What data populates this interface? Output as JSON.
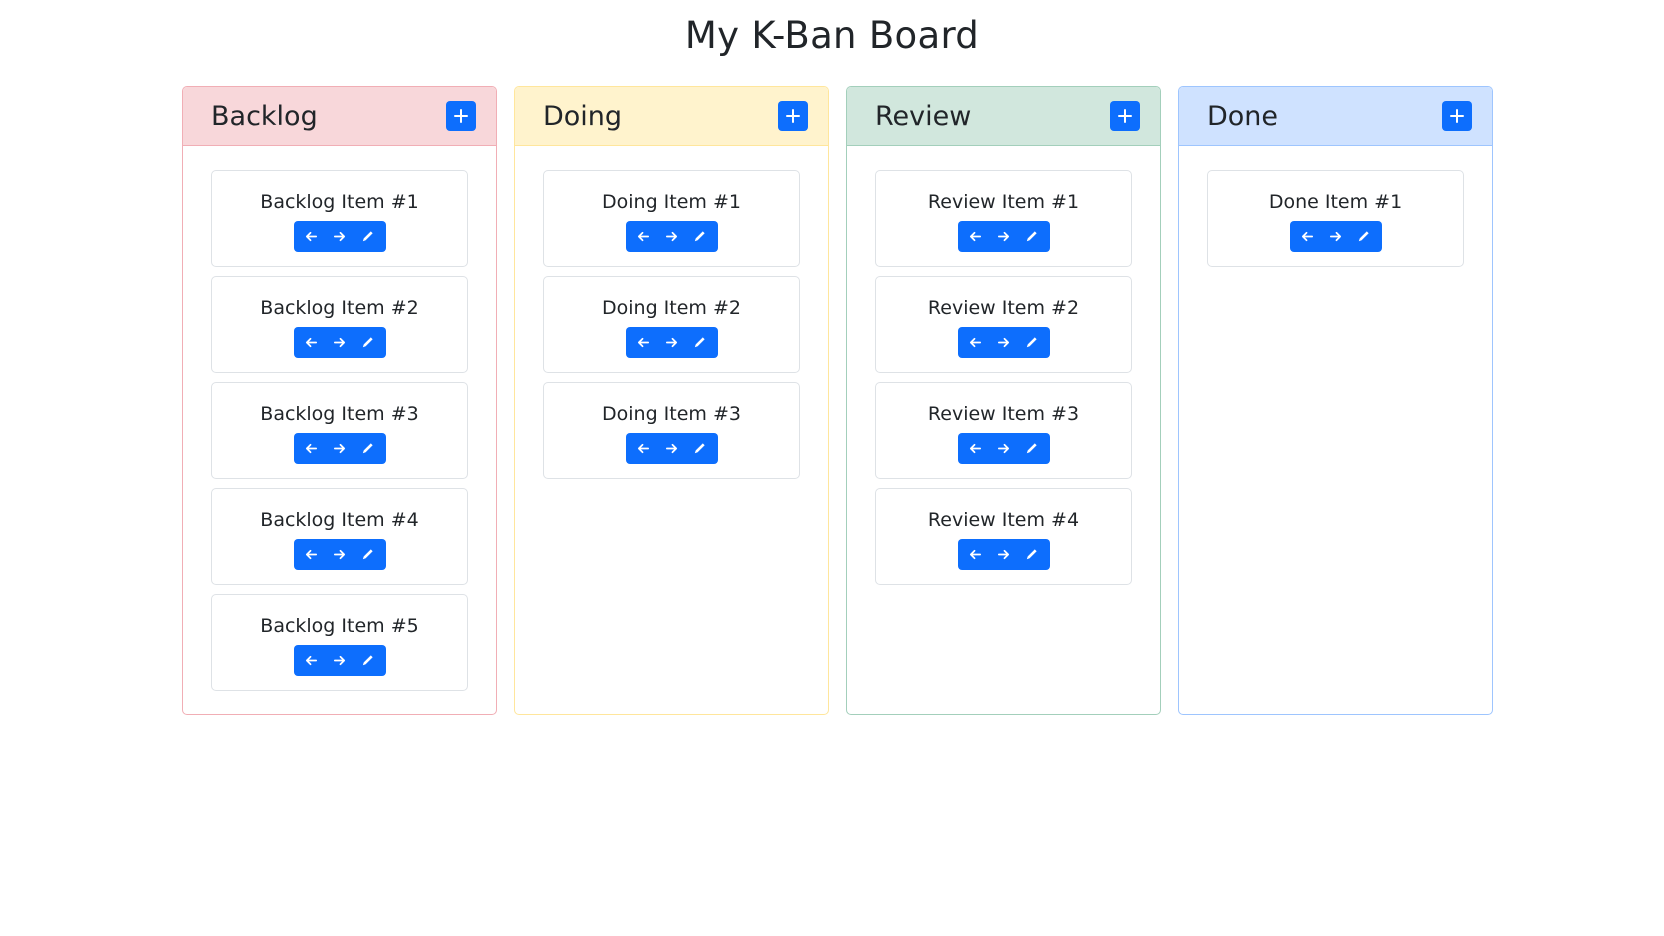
{
  "page": {
    "title": "My K-Ban Board"
  },
  "colors": {
    "accent": "#0d6efd",
    "backlog_header": "#f8d7da",
    "doing_header": "#fff3cd",
    "review_header": "#d1e7dd",
    "done_header": "#cfe2ff"
  },
  "icons": {
    "add": "plus-icon",
    "move_left": "arrow-left-icon",
    "move_right": "arrow-right-icon",
    "edit": "pencil-icon"
  },
  "columns": [
    {
      "key": "backlog",
      "title": "Backlog",
      "items": [
        "Backlog Item #1",
        "Backlog Item #2",
        "Backlog Item #3",
        "Backlog Item #4",
        "Backlog Item #5"
      ]
    },
    {
      "key": "doing",
      "title": "Doing",
      "items": [
        "Doing Item #1",
        "Doing Item #2",
        "Doing Item #3"
      ]
    },
    {
      "key": "review",
      "title": "Review",
      "items": [
        "Review Item #1",
        "Review Item #2",
        "Review Item #3",
        "Review Item #4"
      ]
    },
    {
      "key": "done",
      "title": "Done",
      "items": [
        "Done Item #1"
      ]
    }
  ]
}
